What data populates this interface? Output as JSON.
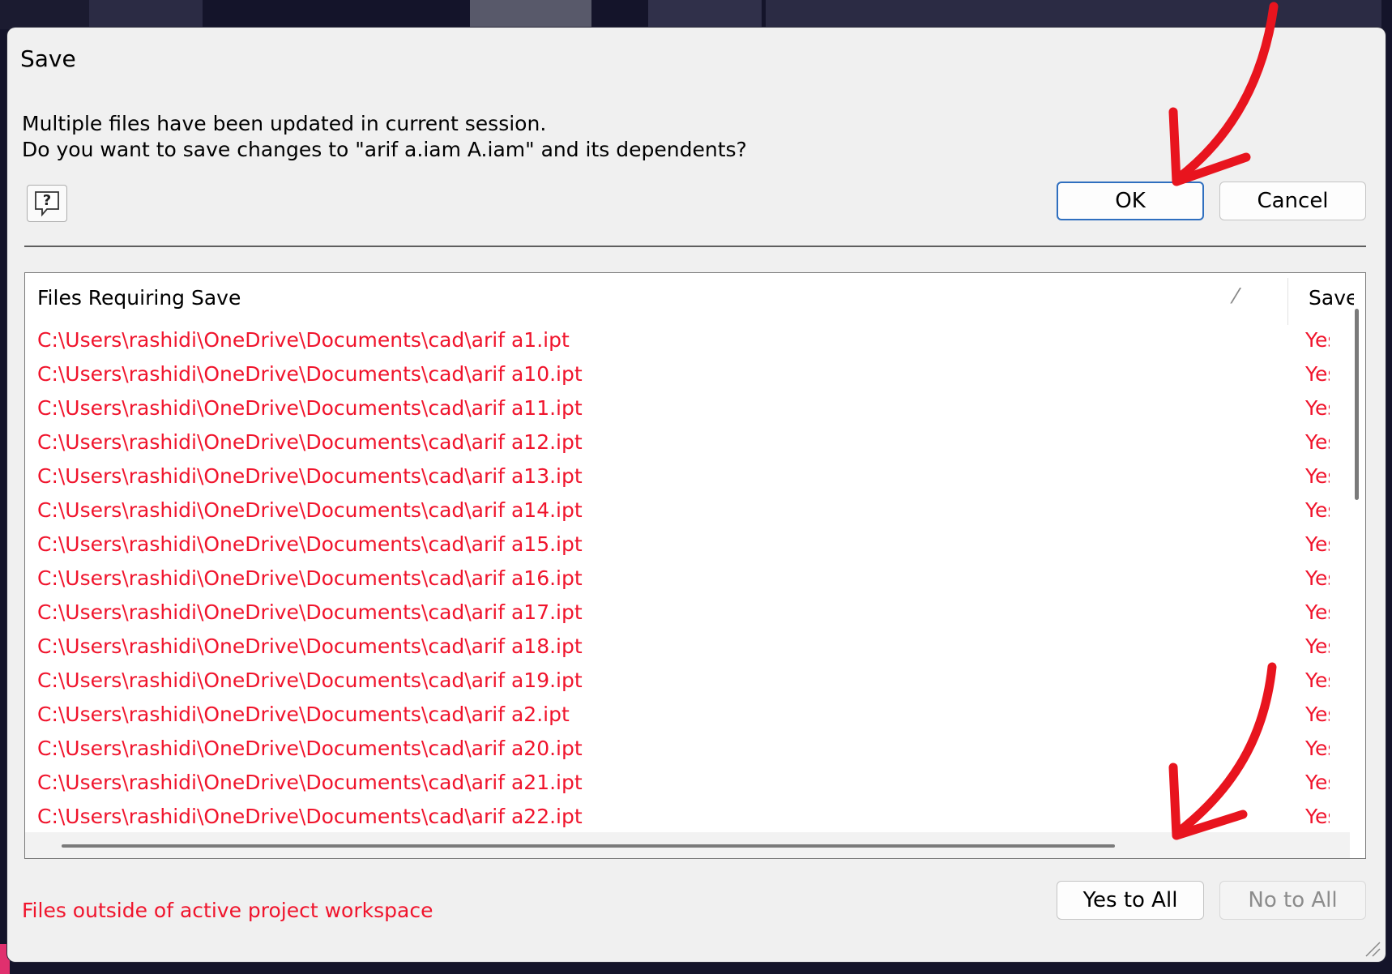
{
  "dialog": {
    "title": "Save",
    "message_line1": "Multiple files have been updated in current session.",
    "message_line2": "Do you want to save changes to \"arif a.iam A.iam\" and its dependents?",
    "help_icon": "help-question-icon",
    "ok_label": "OK",
    "cancel_label": "Cancel",
    "yes_to_all_label": "Yes to All",
    "no_to_all_label": "No to All",
    "footer_note": "Files outside of active project workspace"
  },
  "table": {
    "col_files": "Files Requiring Save",
    "col_save": "Save",
    "sort_indicator": "⁄",
    "rows": [
      {
        "path": "C:\\Users\\rashidi\\OneDrive\\Documents\\cad\\arif a1.ipt",
        "save": "Yes"
      },
      {
        "path": "C:\\Users\\rashidi\\OneDrive\\Documents\\cad\\arif a10.ipt",
        "save": "Yes"
      },
      {
        "path": "C:\\Users\\rashidi\\OneDrive\\Documents\\cad\\arif a11.ipt",
        "save": "Yes"
      },
      {
        "path": "C:\\Users\\rashidi\\OneDrive\\Documents\\cad\\arif a12.ipt",
        "save": "Yes"
      },
      {
        "path": "C:\\Users\\rashidi\\OneDrive\\Documents\\cad\\arif a13.ipt",
        "save": "Yes"
      },
      {
        "path": "C:\\Users\\rashidi\\OneDrive\\Documents\\cad\\arif a14.ipt",
        "save": "Yes"
      },
      {
        "path": "C:\\Users\\rashidi\\OneDrive\\Documents\\cad\\arif a15.ipt",
        "save": "Yes"
      },
      {
        "path": "C:\\Users\\rashidi\\OneDrive\\Documents\\cad\\arif a16.ipt",
        "save": "Yes"
      },
      {
        "path": "C:\\Users\\rashidi\\OneDrive\\Documents\\cad\\arif a17.ipt",
        "save": "Yes"
      },
      {
        "path": "C:\\Users\\rashidi\\OneDrive\\Documents\\cad\\arif a18.ipt",
        "save": "Yes"
      },
      {
        "path": "C:\\Users\\rashidi\\OneDrive\\Documents\\cad\\arif a19.ipt",
        "save": "Yes"
      },
      {
        "path": "C:\\Users\\rashidi\\OneDrive\\Documents\\cad\\arif a2.ipt",
        "save": "Yes"
      },
      {
        "path": "C:\\Users\\rashidi\\OneDrive\\Documents\\cad\\arif a20.ipt",
        "save": "Yes"
      },
      {
        "path": "C:\\Users\\rashidi\\OneDrive\\Documents\\cad\\arif a21.ipt",
        "save": "Yes"
      },
      {
        "path": "C:\\Users\\rashidi\\OneDrive\\Documents\\cad\\arif a22.ipt",
        "save": "Yes"
      }
    ]
  },
  "colors": {
    "file_text": "#f0142c",
    "ok_border": "#2f6fbf",
    "annotation_arrow": "#e8141e"
  }
}
